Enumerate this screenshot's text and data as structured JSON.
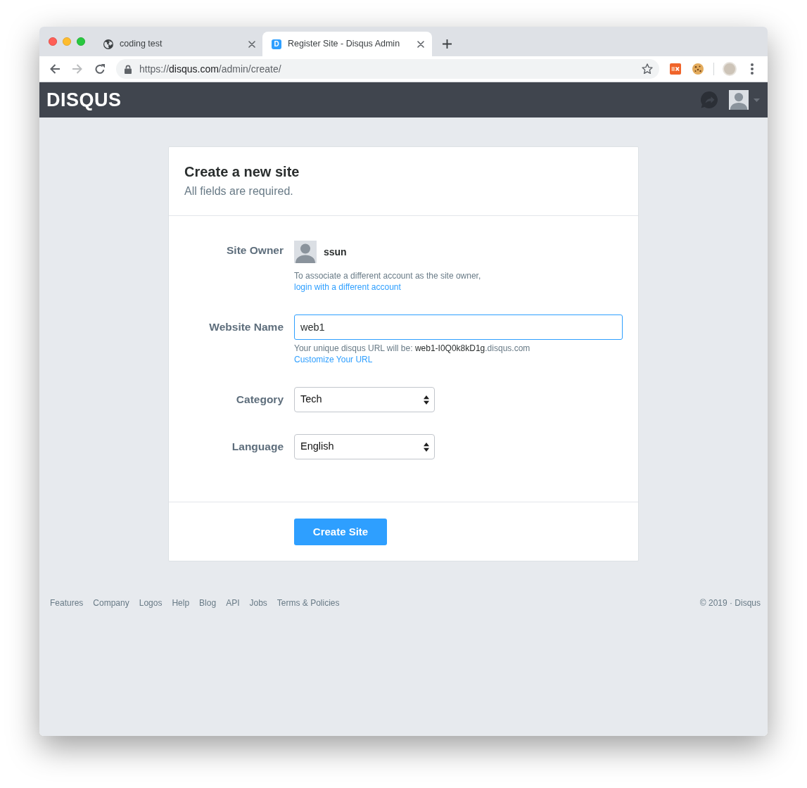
{
  "browser": {
    "tabs": [
      {
        "title": "coding test",
        "selected": false
      },
      {
        "title": "Register Site - Disqus Admin",
        "selected": true,
        "favicon": "D"
      }
    ],
    "navigation": {
      "back_enabled": true,
      "forward_enabled": false
    },
    "address_bar": {
      "scheme": "https://",
      "host": "disqus.com",
      "path": "/admin/create/"
    }
  },
  "header": {
    "logo": "DISQUS"
  },
  "card": {
    "title": "Create a new site",
    "subtitle": "All fields are required.",
    "fields": [
      {
        "kind": "owner",
        "label": "Site Owner",
        "username": "ssun",
        "note": "To associate a different account as the site owner,",
        "link": "login with a different account"
      },
      {
        "kind": "text",
        "label": "Website Name",
        "value": "web1",
        "focused": true,
        "hint": "Your unique disqus URL will be: ",
        "url_slug": "web1-I0Q0k8kD1g",
        "url_domain": ".disqus.com",
        "link": "Customize Your URL"
      },
      {
        "kind": "select",
        "label": "Category",
        "value": "Tech"
      },
      {
        "kind": "select",
        "label": "Language",
        "value": "English"
      }
    ],
    "submit": "Create Site"
  },
  "footer": {
    "links": [
      "Features",
      "Company",
      "Logos",
      "Help",
      "Blog",
      "API",
      "Jobs",
      "Terms & Policies"
    ],
    "copyright": "© 2019 · Disqus"
  }
}
